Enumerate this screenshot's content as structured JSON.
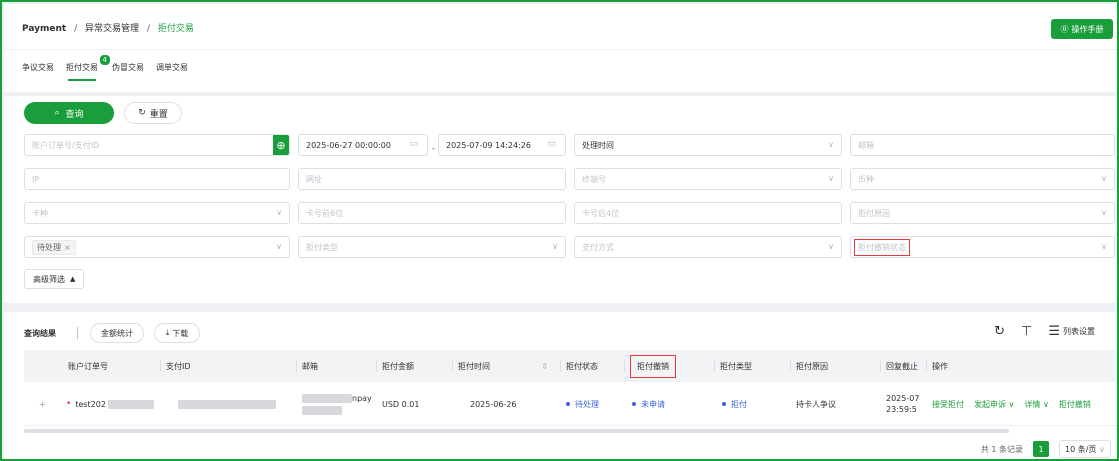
{
  "breadcrumb": {
    "root": "Payment",
    "sep": "/",
    "level2": "异常交易管理",
    "current": "拒付交易"
  },
  "manual_button": "操作手册",
  "tabs": [
    {
      "label": "争议交易"
    },
    {
      "label": "拒付交易",
      "badge": "4"
    },
    {
      "label": "伪冒交易"
    },
    {
      "label": "调单交易"
    }
  ],
  "buttons": {
    "query": "查询",
    "reset": "重置"
  },
  "filters": {
    "order_placeholder": "账户订单号/支付ID",
    "start_time": "2025-06-27 00:00:00",
    "range_sep": "-",
    "end_time": "2025-07-09 14:24:26",
    "time_type": "处理时间",
    "email_placeholder": "邮箱",
    "ip_placeholder": "IP",
    "url_placeholder": "网址",
    "terminal_placeholder": "终端号",
    "currency_placeholder": "币种",
    "card_type_placeholder": "卡种",
    "card_first6_placeholder": "卡号前6位",
    "card_last4_placeholder": "卡号后4位",
    "chargeback_reason_placeholder": "拒付原因",
    "status_tag": "待处理",
    "chargeback_type_placeholder": "拒付类型",
    "payment_method_placeholder": "支付方式",
    "revoke_status_placeholder": "拒付撤销状态",
    "advanced": "高级筛选"
  },
  "results": {
    "title": "查询结果",
    "amount_stats": "金额统计",
    "download": "下载",
    "column_settings": "列表设置",
    "columns": [
      "账户订单号",
      "支付ID",
      "邮箱",
      "拒付金额",
      "拒付时间",
      "拒付状态",
      "拒付撤销",
      "拒付类型",
      "拒付原因",
      "回复截止",
      "操作"
    ],
    "row": {
      "expand": "+",
      "order_prefix": "test202",
      "email_suffix": "npay",
      "amount": "USD 0.01",
      "chargeback_time": "2025-06-26",
      "status": "待处理",
      "revoke": "未申请",
      "type": "拒付",
      "reason": "持卡人争议",
      "deadline_line1": "2025-07",
      "deadline_line2": "23:59:5",
      "actions": {
        "accept": "接受拒付",
        "appeal": "发起申诉",
        "detail": "详情",
        "revoke": "拒付撤销"
      }
    },
    "footer": {
      "total": "共 1 条记录",
      "page": "1",
      "page_size": "10 条/页"
    }
  },
  "colors": {
    "primary": "#1a9e3b",
    "status_blue": "#3a63d8",
    "highlight_red": "#e33b3b"
  }
}
